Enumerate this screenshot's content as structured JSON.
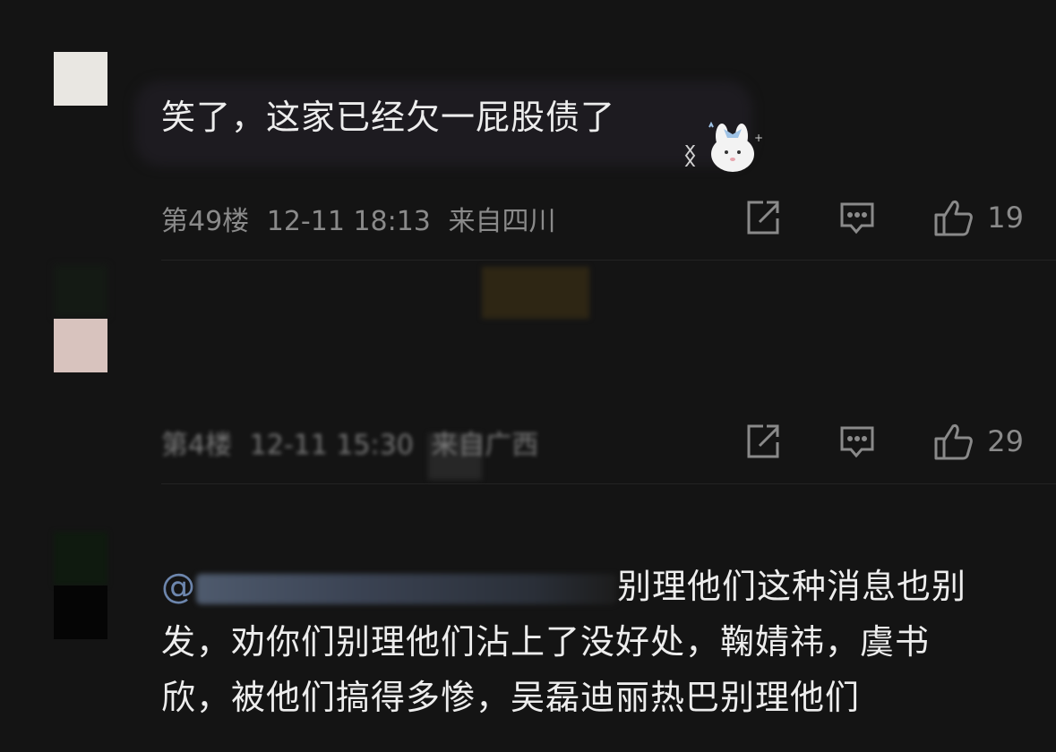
{
  "comments": [
    {
      "text": "笑了，这家已经欠一屁股债了",
      "floor": "第49楼",
      "time": "12-11 18:13",
      "location": "来自四川",
      "likes": "19",
      "avatar_color": "#e9e7e2",
      "sticker": "bunny-sticker"
    },
    {
      "text": "",
      "floor": "第4楼",
      "time": "12-11 15:30",
      "location": "来自广西",
      "likes": "29",
      "avatar_color": "#d8c3be"
    },
    {
      "mention": "@",
      "text_line1": "别理他们这种消息也别",
      "text_line2": "发，劝你们别理他们沾上了没好处，鞠婧祎，虞书",
      "text_line3": "欣，被他们搞得多惨，吴磊迪丽热巴别理他们",
      "avatar_color": "#050505"
    }
  ],
  "icons": {
    "share": "share-icon",
    "reply": "comment-icon",
    "like": "thumbs-up-icon"
  },
  "colors": {
    "background": "#141414",
    "text": "#ededed",
    "meta": "#8a8a8a",
    "mention": "#6d86ad"
  }
}
